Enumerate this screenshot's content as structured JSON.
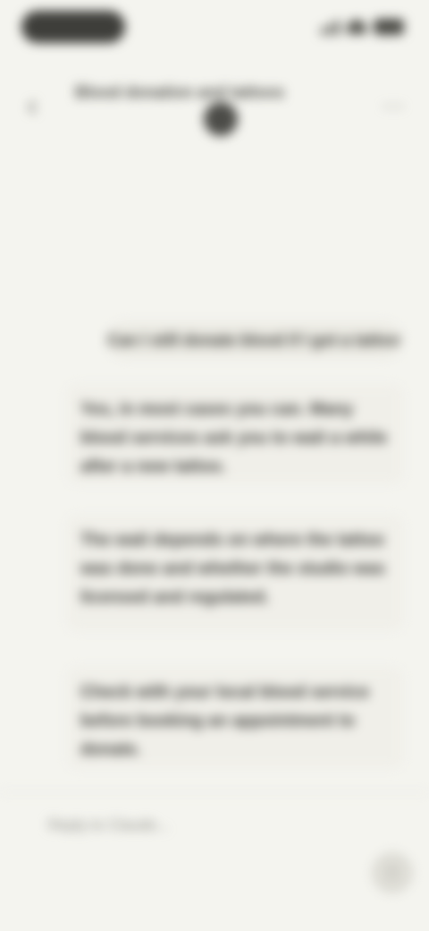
{
  "status_bar": {
    "time": "14:22",
    "icons": [
      "signal-icon",
      "wifi-icon",
      "battery-icon"
    ]
  },
  "header": {
    "back_icon": "‹",
    "title": "Blood donation and tattoos",
    "menu_icon": "⋯"
  },
  "messages": [
    {
      "role": "user",
      "text": "Can I still donate blood if I got a tattoo?"
    },
    {
      "role": "assistant",
      "text": "Yes, in most cases you can. Many blood services ask you to wait a while after a new tattoo."
    },
    {
      "role": "assistant",
      "text": "The wait depends on where the tattoo was done and whether the studio was licensed and regulated."
    },
    {
      "role": "assistant",
      "text": "Check with your local blood service before booking an appointment to donate."
    }
  ],
  "composer": {
    "placeholder": "Reply to Claude...",
    "send_icon": "↑"
  },
  "colors": {
    "background": "#f4f4ef",
    "bubble": "#ecebe4",
    "text": "#2e2e2a"
  }
}
